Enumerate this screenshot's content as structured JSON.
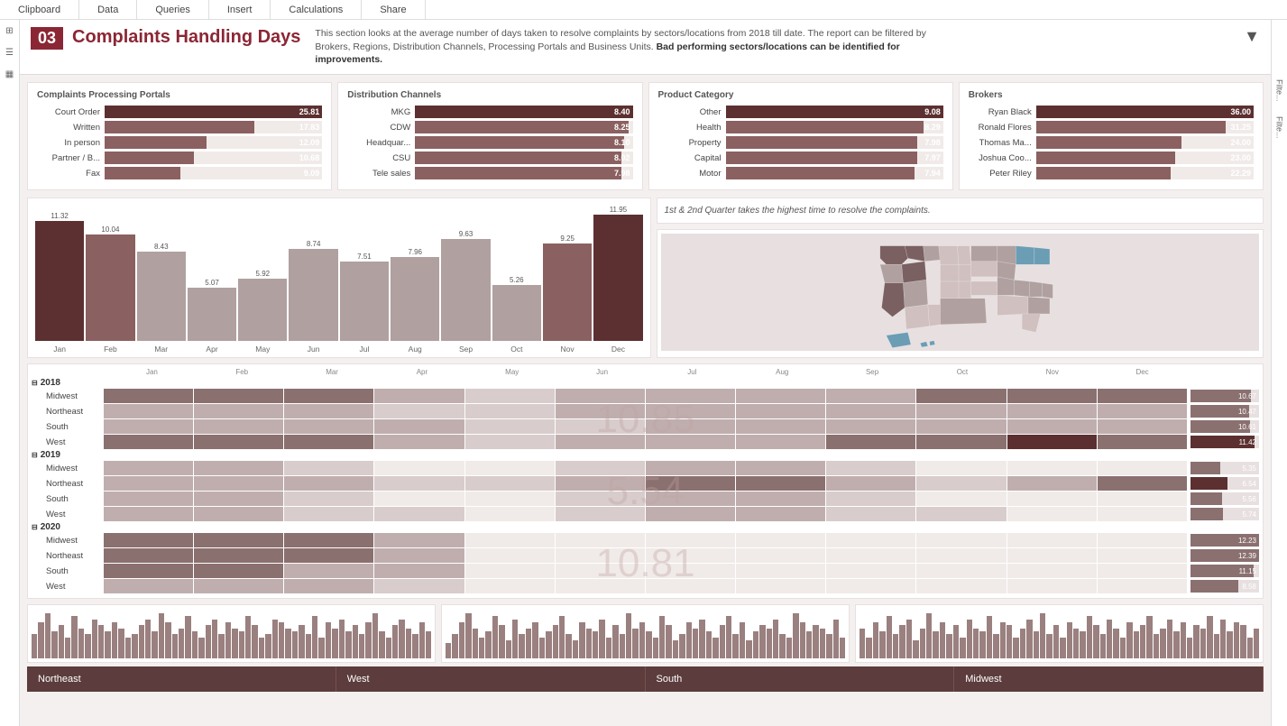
{
  "topbar": {
    "items": [
      "Clipboard",
      "Data",
      "Queries",
      "Insert",
      "Calculations",
      "Share"
    ]
  },
  "header": {
    "number": "03",
    "title": "Complaints Handling Days",
    "description": "This section looks at the average number of days taken to resolve complaints by sectors/locations from 2018 till date. The report can be filtered by Brokers, Regions, Distribution Channels, Processing Portals and Business Units.",
    "description_bold": "Bad performing sectors/locations can be identified for improvements."
  },
  "portals": {
    "title": "Complaints Processing Portals",
    "items": [
      {
        "label": "Court Order",
        "value": 25.81,
        "pct": 100
      },
      {
        "label": "Written",
        "value": 17.83,
        "pct": 69
      },
      {
        "label": "In person",
        "value": 12.09,
        "pct": 47
      },
      {
        "label": "Partner / B...",
        "value": 10.68,
        "pct": 41
      },
      {
        "label": "Fax",
        "value": 9.09,
        "pct": 35
      }
    ]
  },
  "channels": {
    "title": "Distribution Channels",
    "items": [
      {
        "label": "MKG",
        "value": 8.4,
        "pct": 100
      },
      {
        "label": "CDW",
        "value": 8.25,
        "pct": 98
      },
      {
        "label": "Headquar...",
        "value": 8.1,
        "pct": 96
      },
      {
        "label": "CSU",
        "value": 8.02,
        "pct": 95
      },
      {
        "label": "Tele sales",
        "value": 7.98,
        "pct": 95
      }
    ]
  },
  "product": {
    "title": "Product Category",
    "items": [
      {
        "label": "Other",
        "value": 9.08,
        "pct": 100
      },
      {
        "label": "Health",
        "value": 8.29,
        "pct": 91
      },
      {
        "label": "Property",
        "value": 7.98,
        "pct": 88
      },
      {
        "label": "Capital",
        "value": 7.97,
        "pct": 88
      },
      {
        "label": "Motor",
        "value": 7.94,
        "pct": 87
      }
    ]
  },
  "brokers": {
    "title": "Brokers",
    "items": [
      {
        "label": "Ryan Black",
        "value": 36.0,
        "pct": 100
      },
      {
        "label": "Ronald Flores",
        "value": 31.25,
        "pct": 87
      },
      {
        "label": "Thomas Ma...",
        "value": 24.0,
        "pct": 67
      },
      {
        "label": "Joshua Coo...",
        "value": 23.0,
        "pct": 64
      },
      {
        "label": "Peter Riley",
        "value": 22.29,
        "pct": 62
      }
    ]
  },
  "monthly_chart": {
    "insight": "1st & 2nd Quarter takes the highest time to resolve the complaints.",
    "months": [
      "Jan",
      "Feb",
      "Mar",
      "Apr",
      "May",
      "Jun",
      "Jul",
      "Aug",
      "Sep",
      "Oct",
      "Nov",
      "Dec"
    ],
    "values": [
      11.32,
      10.04,
      8.43,
      5.07,
      5.92,
      8.74,
      7.51,
      7.96,
      9.63,
      5.26,
      9.25,
      11.95
    ],
    "max": 11.95
  },
  "heatmap": {
    "years": [
      {
        "year": "2018",
        "overlay": "10.85",
        "regions": [
          {
            "name": "Midwest",
            "side_val": "10.67",
            "side_pct": 88,
            "dark": false
          },
          {
            "name": "Northeast",
            "side_val": "10.47",
            "side_pct": 86,
            "dark": false
          },
          {
            "name": "South",
            "side_val": "10.61",
            "side_pct": 87,
            "dark": false
          },
          {
            "name": "West",
            "side_val": "11.42",
            "side_pct": 94,
            "dark": true
          }
        ]
      },
      {
        "year": "2019",
        "overlay": "5.54",
        "regions": [
          {
            "name": "Midwest",
            "side_val": "5.35",
            "side_pct": 44,
            "dark": false
          },
          {
            "name": "Northeast",
            "side_val": "6.54",
            "side_pct": 54,
            "dark": true
          },
          {
            "name": "South",
            "side_val": "5.56",
            "side_pct": 46,
            "dark": false
          },
          {
            "name": "West",
            "side_val": "5.74",
            "side_pct": 47,
            "dark": false
          }
        ]
      },
      {
        "year": "2020",
        "overlay": "10.81",
        "regions": [
          {
            "name": "Midwest",
            "side_val": "12.23",
            "side_pct": 100,
            "dark": false
          },
          {
            "name": "Northeast",
            "side_val": "12.39",
            "side_pct": 100,
            "dark": false
          },
          {
            "name": "South",
            "side_val": "11.15",
            "side_pct": 92,
            "dark": false
          },
          {
            "name": "West",
            "side_val": "8.58",
            "side_pct": 70,
            "dark": false
          }
        ]
      }
    ]
  },
  "footer": {
    "items": [
      "Northeast",
      "West",
      "South",
      "Midwest"
    ]
  }
}
